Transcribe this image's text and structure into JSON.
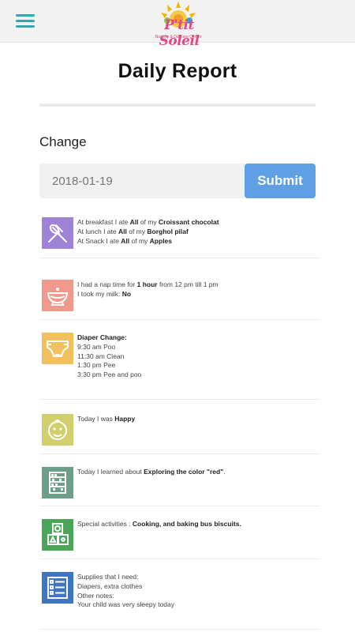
{
  "header": {
    "logo_text": "P'tit Soleil",
    "logo_subtitle": "Nursery & Daycare Center"
  },
  "page": {
    "title": "Daily Report",
    "change_label": "Change",
    "date_value": "2018-01-19",
    "submit_label": "Submit"
  },
  "colors": {
    "teal_menu": "#3aa3b0",
    "submit_blue": "#5f9fe3",
    "meals": "#9f83d6",
    "nap": "#ef9a8c",
    "diaper": "#f2c15e",
    "mood": "#d2cf6e",
    "learning": "#6d9e8a",
    "activities": "#4aa75a",
    "supplies": "#3f76c0"
  },
  "reports": {
    "meals": {
      "icon": "fork-spoon-icon",
      "breakfast": [
        "At breakfast I ate ",
        "All",
        " of my ",
        "Croissant chocolat"
      ],
      "lunch": [
        "At lunch I ate ",
        "All",
        " of my ",
        "Borghol pilaf"
      ],
      "snack": [
        "At Snack I ate ",
        "All",
        " of my ",
        "Apples"
      ]
    },
    "nap": {
      "icon": "bowl-icon",
      "nap_line": [
        "I had a nap time for ",
        "1 hour",
        " from 12 pm till 1 pm"
      ],
      "milk_line": [
        "I took my milk: ",
        "No"
      ]
    },
    "diaper": {
      "icon": "diaper-icon",
      "heading": "Diaper Change:",
      "entries": [
        "9:30 am Poo",
        "11:30 am Clean",
        "1:30 pm Pee",
        "3:30 pm Pee and poo"
      ]
    },
    "mood": {
      "icon": "baby-face-icon",
      "line": [
        "Today I was ",
        "Happy"
      ]
    },
    "learning": {
      "icon": "abacus-icon",
      "line": [
        "Today I learned about ",
        "Exploring the color \"red\"",
        "."
      ]
    },
    "activities": {
      "icon": "toy-blocks-icon",
      "line": [
        "Special activities : ",
        "Cooking, and baking bus biscuits."
      ]
    },
    "supplies": {
      "icon": "checklist-icon",
      "lines": [
        "Supplies that I need:",
        "Diapers, extra clothes",
        "Other notes:",
        "Your child was very sleepy today"
      ]
    }
  }
}
